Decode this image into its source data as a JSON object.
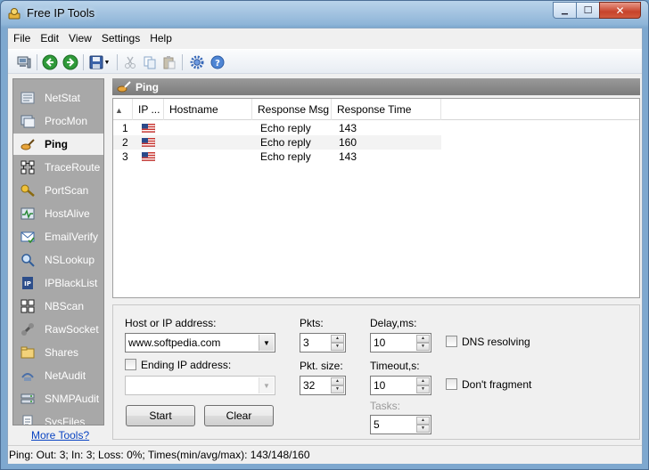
{
  "window": {
    "title": "Free IP Tools",
    "minimize_glyph": "▁",
    "maximize_glyph": "☐",
    "close_glyph": "✕"
  },
  "menubar": {
    "items": [
      "File",
      "Edit",
      "View",
      "Settings",
      "Help"
    ]
  },
  "toolbar": {
    "icons": [
      "computer-icon",
      "back-arrow-icon",
      "forward-arrow-icon",
      "save-icon",
      "cut-icon",
      "copy-icon",
      "paste-icon",
      "settings-icon",
      "help-icon"
    ]
  },
  "sidebar": {
    "items": [
      {
        "label": "NetStat",
        "icon": "netstat-icon",
        "active": false
      },
      {
        "label": "ProcMon",
        "icon": "procmon-icon",
        "active": false
      },
      {
        "label": "Ping",
        "icon": "ping-icon",
        "active": true
      },
      {
        "label": "TraceRoute",
        "icon": "traceroute-icon",
        "active": false
      },
      {
        "label": "PortScan",
        "icon": "portscan-icon",
        "active": false
      },
      {
        "label": "HostAlive",
        "icon": "hostalive-icon",
        "active": false
      },
      {
        "label": "EmailVerify",
        "icon": "emailverify-icon",
        "active": false
      },
      {
        "label": "NSLookup",
        "icon": "nslookup-icon",
        "active": false
      },
      {
        "label": "IPBlackList",
        "icon": "ipblacklist-icon",
        "active": false
      },
      {
        "label": "NBScan",
        "icon": "nbscan-icon",
        "active": false
      },
      {
        "label": "RawSocket",
        "icon": "rawsocket-icon",
        "active": false
      },
      {
        "label": "Shares",
        "icon": "shares-icon",
        "active": false
      },
      {
        "label": "NetAudit",
        "icon": "netaudit-icon",
        "active": false
      },
      {
        "label": "SNMPAudit",
        "icon": "snmpaudit-icon",
        "active": false
      },
      {
        "label": "SysFiles",
        "icon": "sysfiles-icon",
        "active": false
      }
    ],
    "more_tools": "More Tools?"
  },
  "panel": {
    "title": "Ping"
  },
  "results": {
    "columns": [
      "",
      "IP ...",
      "Hostname",
      "Response Msg",
      "Response Time"
    ],
    "rows": [
      {
        "num": "1",
        "flag": "us-flag-icon",
        "hostname": "",
        "msg": "Echo reply",
        "time": "143"
      },
      {
        "num": "2",
        "flag": "us-flag-icon",
        "hostname": "",
        "msg": "Echo reply",
        "time": "160"
      },
      {
        "num": "3",
        "flag": "us-flag-icon",
        "hostname": "",
        "msg": "Echo reply",
        "time": "143"
      }
    ]
  },
  "form": {
    "host_label": "Host or IP address:",
    "host_value": "www.softpedia.com",
    "ending_ip_label": "Ending IP address:",
    "ending_ip_value": "",
    "pkts_label": "Pkts:",
    "pkts_value": "3",
    "pkt_size_label": "Pkt. size:",
    "pkt_size_value": "32",
    "delay_label": "Delay,ms:",
    "delay_value": "10",
    "timeout_label": "Timeout,s:",
    "timeout_value": "10",
    "tasks_label": "Tasks:",
    "tasks_value": "5",
    "dns_label": "DNS resolving",
    "dont_fragment_label": "Don't fragment",
    "start_label": "Start",
    "clear_label": "Clear"
  },
  "status": {
    "text": "Ping: Out: 3; In: 3; Loss: 0%; Times(min/avg/max): 143/148/160"
  }
}
